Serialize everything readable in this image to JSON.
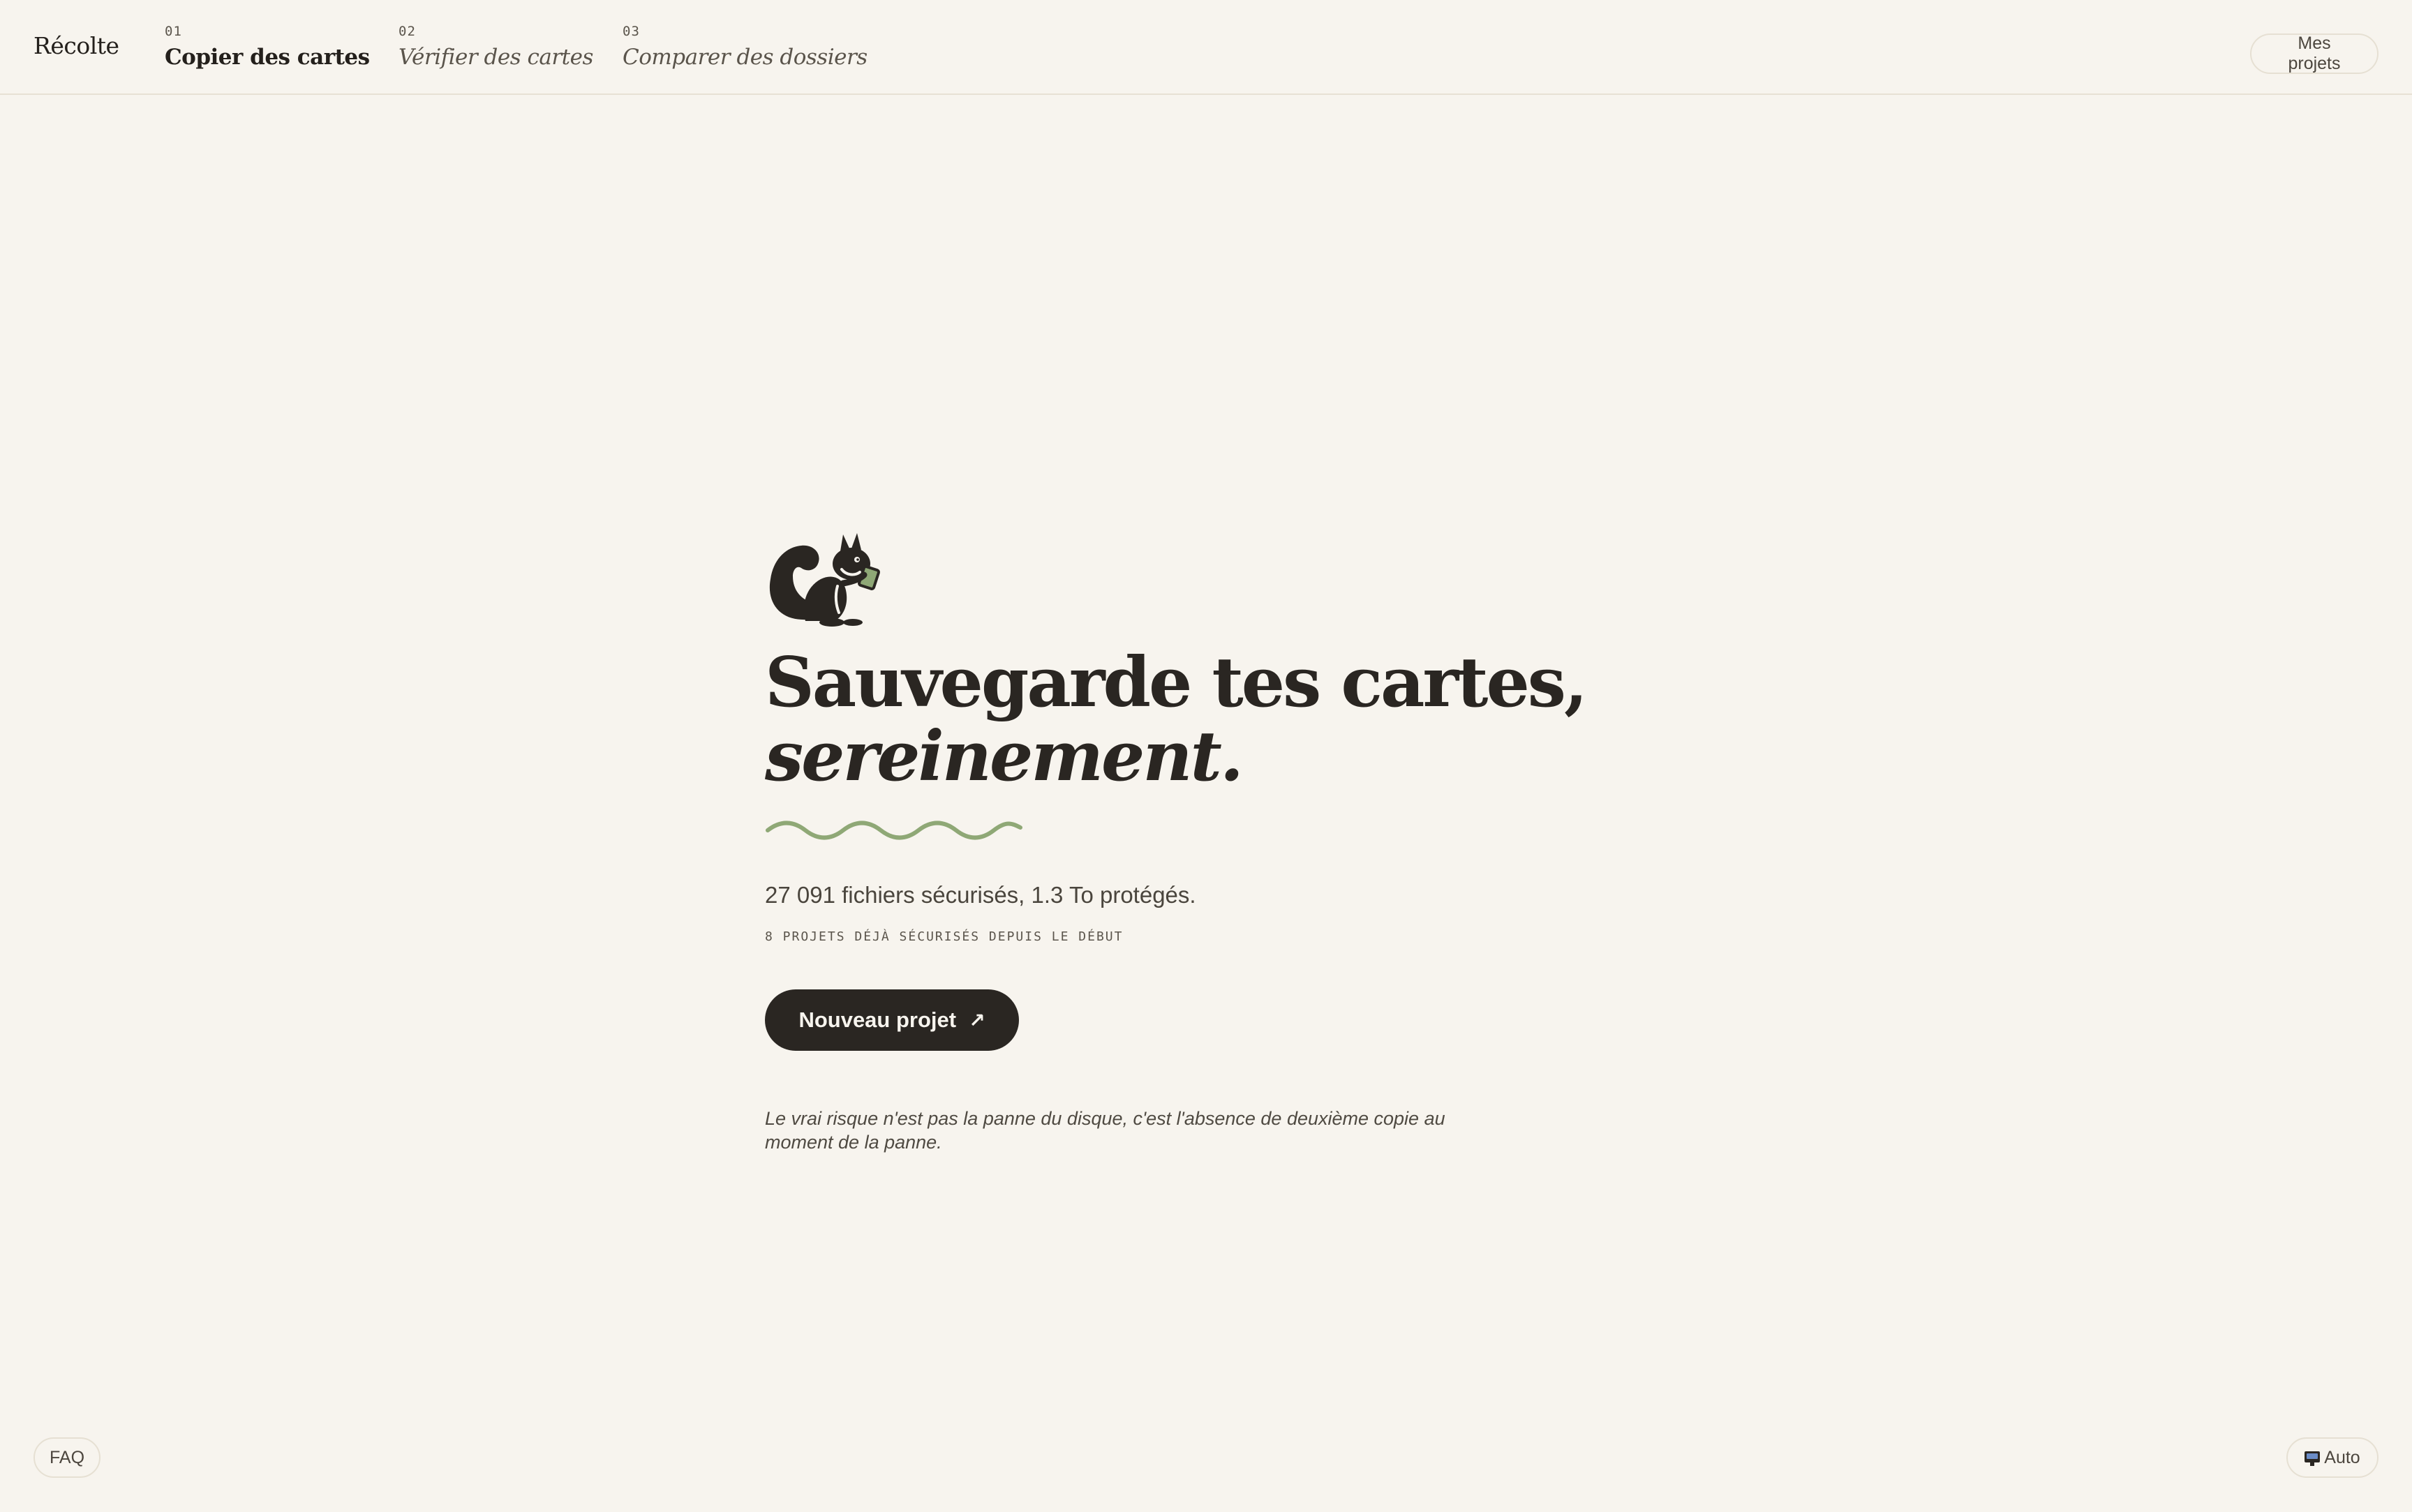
{
  "header": {
    "brand": "Récolte",
    "steps": [
      {
        "number": "01",
        "label": "Copier des cartes",
        "active": true
      },
      {
        "number": "02",
        "label": "Vérifier des cartes",
        "active": false
      },
      {
        "number": "03",
        "label": "Comparer des dossiers",
        "active": false
      }
    ],
    "projects_button": "Mes projets"
  },
  "hero": {
    "icon": "squirrel-icon",
    "headline_line1": "Sauvegarde tes cartes,",
    "headline_line2": "sereinement.",
    "stats": "27 091 fichiers sécurisés, 1.3 To protégés.",
    "caption": "8 PROJETS DÉJÀ SÉCURISÉS DEPUIS LE DÉBUT",
    "cta_label": "Nouveau projet",
    "cta_icon": "arrow-up-right-icon",
    "quote": "Le vrai risque n'est pas la panne du disque, c'est l'absence de deuxième copie au moment de la panne."
  },
  "footer": {
    "faq_label": "FAQ",
    "theme_label": "Auto",
    "theme_icon": "monitor-icon"
  },
  "colors": {
    "background": "#f7f4ee",
    "ink": "#2a2622",
    "accent_wave": "#8fa876",
    "border": "#e6e0d3"
  }
}
